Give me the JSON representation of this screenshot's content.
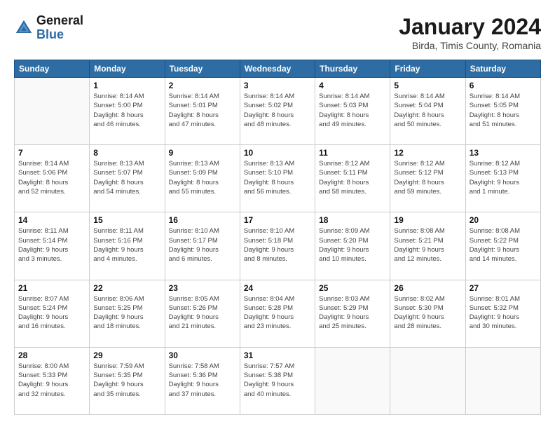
{
  "header": {
    "logo_line1": "General",
    "logo_line2": "Blue",
    "title": "January 2024",
    "location": "Birda, Timis County, Romania"
  },
  "days_of_week": [
    "Sunday",
    "Monday",
    "Tuesday",
    "Wednesday",
    "Thursday",
    "Friday",
    "Saturday"
  ],
  "weeks": [
    [
      {
        "day": "",
        "info": ""
      },
      {
        "day": "1",
        "info": "Sunrise: 8:14 AM\nSunset: 5:00 PM\nDaylight: 8 hours\nand 46 minutes."
      },
      {
        "day": "2",
        "info": "Sunrise: 8:14 AM\nSunset: 5:01 PM\nDaylight: 8 hours\nand 47 minutes."
      },
      {
        "day": "3",
        "info": "Sunrise: 8:14 AM\nSunset: 5:02 PM\nDaylight: 8 hours\nand 48 minutes."
      },
      {
        "day": "4",
        "info": "Sunrise: 8:14 AM\nSunset: 5:03 PM\nDaylight: 8 hours\nand 49 minutes."
      },
      {
        "day": "5",
        "info": "Sunrise: 8:14 AM\nSunset: 5:04 PM\nDaylight: 8 hours\nand 50 minutes."
      },
      {
        "day": "6",
        "info": "Sunrise: 8:14 AM\nSunset: 5:05 PM\nDaylight: 8 hours\nand 51 minutes."
      }
    ],
    [
      {
        "day": "7",
        "info": "Sunrise: 8:14 AM\nSunset: 5:06 PM\nDaylight: 8 hours\nand 52 minutes."
      },
      {
        "day": "8",
        "info": "Sunrise: 8:13 AM\nSunset: 5:07 PM\nDaylight: 8 hours\nand 54 minutes."
      },
      {
        "day": "9",
        "info": "Sunrise: 8:13 AM\nSunset: 5:09 PM\nDaylight: 8 hours\nand 55 minutes."
      },
      {
        "day": "10",
        "info": "Sunrise: 8:13 AM\nSunset: 5:10 PM\nDaylight: 8 hours\nand 56 minutes."
      },
      {
        "day": "11",
        "info": "Sunrise: 8:12 AM\nSunset: 5:11 PM\nDaylight: 8 hours\nand 58 minutes."
      },
      {
        "day": "12",
        "info": "Sunrise: 8:12 AM\nSunset: 5:12 PM\nDaylight: 8 hours\nand 59 minutes."
      },
      {
        "day": "13",
        "info": "Sunrise: 8:12 AM\nSunset: 5:13 PM\nDaylight: 9 hours\nand 1 minute."
      }
    ],
    [
      {
        "day": "14",
        "info": "Sunrise: 8:11 AM\nSunset: 5:14 PM\nDaylight: 9 hours\nand 3 minutes."
      },
      {
        "day": "15",
        "info": "Sunrise: 8:11 AM\nSunset: 5:16 PM\nDaylight: 9 hours\nand 4 minutes."
      },
      {
        "day": "16",
        "info": "Sunrise: 8:10 AM\nSunset: 5:17 PM\nDaylight: 9 hours\nand 6 minutes."
      },
      {
        "day": "17",
        "info": "Sunrise: 8:10 AM\nSunset: 5:18 PM\nDaylight: 9 hours\nand 8 minutes."
      },
      {
        "day": "18",
        "info": "Sunrise: 8:09 AM\nSunset: 5:20 PM\nDaylight: 9 hours\nand 10 minutes."
      },
      {
        "day": "19",
        "info": "Sunrise: 8:08 AM\nSunset: 5:21 PM\nDaylight: 9 hours\nand 12 minutes."
      },
      {
        "day": "20",
        "info": "Sunrise: 8:08 AM\nSunset: 5:22 PM\nDaylight: 9 hours\nand 14 minutes."
      }
    ],
    [
      {
        "day": "21",
        "info": "Sunrise: 8:07 AM\nSunset: 5:24 PM\nDaylight: 9 hours\nand 16 minutes."
      },
      {
        "day": "22",
        "info": "Sunrise: 8:06 AM\nSunset: 5:25 PM\nDaylight: 9 hours\nand 18 minutes."
      },
      {
        "day": "23",
        "info": "Sunrise: 8:05 AM\nSunset: 5:26 PM\nDaylight: 9 hours\nand 21 minutes."
      },
      {
        "day": "24",
        "info": "Sunrise: 8:04 AM\nSunset: 5:28 PM\nDaylight: 9 hours\nand 23 minutes."
      },
      {
        "day": "25",
        "info": "Sunrise: 8:03 AM\nSunset: 5:29 PM\nDaylight: 9 hours\nand 25 minutes."
      },
      {
        "day": "26",
        "info": "Sunrise: 8:02 AM\nSunset: 5:30 PM\nDaylight: 9 hours\nand 28 minutes."
      },
      {
        "day": "27",
        "info": "Sunrise: 8:01 AM\nSunset: 5:32 PM\nDaylight: 9 hours\nand 30 minutes."
      }
    ],
    [
      {
        "day": "28",
        "info": "Sunrise: 8:00 AM\nSunset: 5:33 PM\nDaylight: 9 hours\nand 32 minutes."
      },
      {
        "day": "29",
        "info": "Sunrise: 7:59 AM\nSunset: 5:35 PM\nDaylight: 9 hours\nand 35 minutes."
      },
      {
        "day": "30",
        "info": "Sunrise: 7:58 AM\nSunset: 5:36 PM\nDaylight: 9 hours\nand 37 minutes."
      },
      {
        "day": "31",
        "info": "Sunrise: 7:57 AM\nSunset: 5:38 PM\nDaylight: 9 hours\nand 40 minutes."
      },
      {
        "day": "",
        "info": ""
      },
      {
        "day": "",
        "info": ""
      },
      {
        "day": "",
        "info": ""
      }
    ]
  ]
}
